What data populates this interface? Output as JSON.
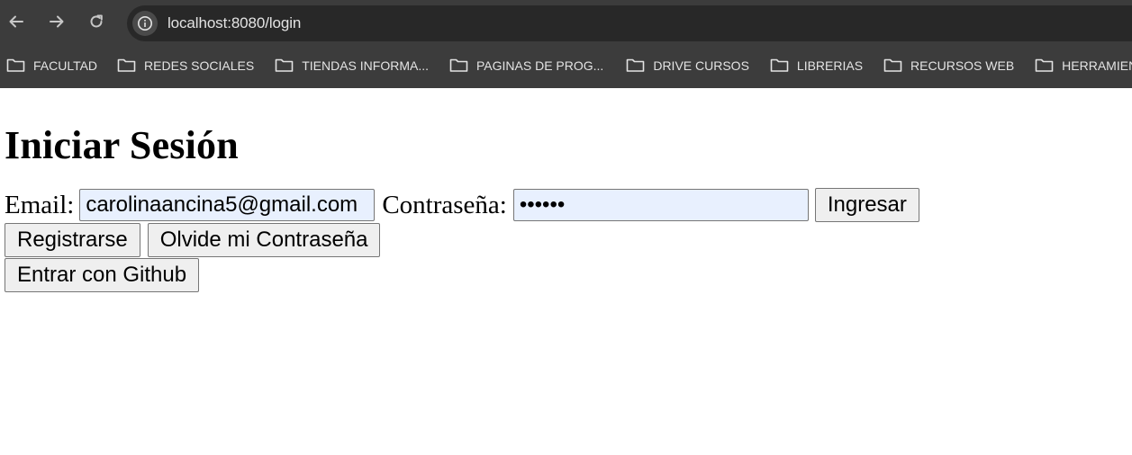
{
  "browser": {
    "url": "localhost:8080/login",
    "bookmarks": [
      {
        "label": "FACULTAD"
      },
      {
        "label": "REDES SOCIALES"
      },
      {
        "label": "TIENDAS INFORMA..."
      },
      {
        "label": "PAGINAS DE PROG..."
      },
      {
        "label": "DRIVE CURSOS"
      },
      {
        "label": "LIBRERIAS"
      },
      {
        "label": "RECURSOS WEB"
      },
      {
        "label": "HERRAMIENTAS"
      }
    ]
  },
  "page": {
    "title": "Iniciar Sesión",
    "email_label": "Email:",
    "email_value": "carolinaancina5@gmail.com",
    "password_label": "Contraseña:",
    "password_value": "••••••",
    "submit_label": "Ingresar",
    "register_label": "Registrarse",
    "forgot_label": "Olvide mi Contraseña",
    "github_label": "Entrar con Github"
  }
}
